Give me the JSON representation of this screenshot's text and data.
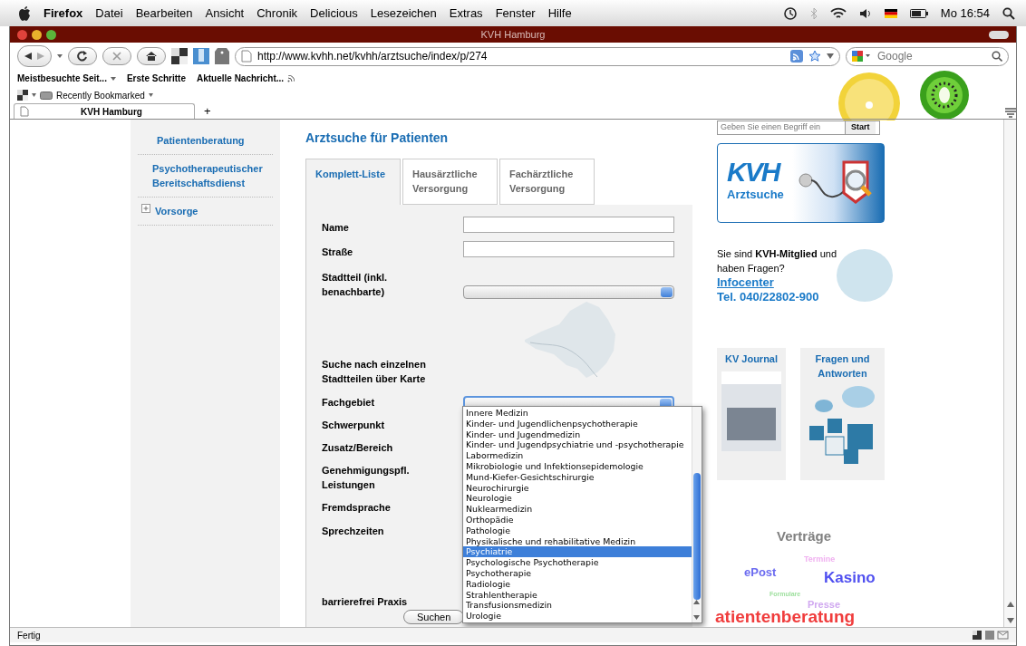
{
  "menubar": {
    "app": "Firefox",
    "menus": [
      "Datei",
      "Bearbeiten",
      "Ansicht",
      "Chronik",
      "Delicious",
      "Lesezeichen",
      "Extras",
      "Fenster",
      "Hilfe"
    ],
    "clock": "Mo 16:54"
  },
  "window": {
    "title": "KVH Hamburg"
  },
  "toolbar": {
    "url": "http://www.kvhh.net/kvhh/arztsuche/index/p/274",
    "search_placeholder": "Google"
  },
  "bookmarks": [
    {
      "label": "Meistbesuchte Seit...",
      "kind": "menu"
    },
    {
      "label": "Erste Schritte",
      "kind": "plain"
    },
    {
      "label": "Aktuelle Nachricht...",
      "kind": "feed"
    }
  ],
  "bookmarks_bar2": {
    "label": "Recently Bookmarked"
  },
  "tabs": [
    {
      "label": "KVH Hamburg",
      "selected": true
    }
  ],
  "new_tab": "+",
  "sidebar": {
    "items": [
      {
        "label": "Patientenberatung",
        "kind": "link"
      },
      {
        "label": "Psychotherapeutischer Bereitschaftsdienst",
        "kind": "link"
      },
      {
        "label": "Vorsorge",
        "kind": "expandable"
      }
    ]
  },
  "main": {
    "title": "Arztsuche für Patienten",
    "tabs": [
      {
        "label": "Komplett-Liste",
        "selected": true
      },
      {
        "label": "Hausärztliche Versorgung",
        "selected": false
      },
      {
        "label": "Fachärztliche Versorgung",
        "selected": false
      }
    ],
    "fields": [
      {
        "label": "Name",
        "kind": "text"
      },
      {
        "label": "Straße",
        "kind": "text"
      },
      {
        "label": "Stadtteil (inkl. benachbarte)",
        "kind": "select",
        "focused": false
      },
      {
        "label": "Suche nach einzelnen Stadtteilen über Karte",
        "kind": "map"
      },
      {
        "label": "Fachgebiet",
        "kind": "select",
        "focused": true
      },
      {
        "label": "Schwerpunkt",
        "kind": "plain"
      },
      {
        "label": "Zusatz/Bereich",
        "kind": "plain"
      },
      {
        "label": "Genehmigungspfl. Leistungen",
        "kind": "plain"
      },
      {
        "label": "Fremdsprache",
        "kind": "plain"
      },
      {
        "label": "Sprechzeiten",
        "kind": "plain"
      },
      {
        "label": "barrierefrei Praxis",
        "kind": "plain"
      }
    ],
    "submit": "Suchen",
    "dropdown": [
      {
        "label": "Innere Medizin",
        "selected": false
      },
      {
        "label": "Kinder- und Jugendlichenpsychotherapie",
        "selected": false
      },
      {
        "label": "Kinder- und Jugendmedizin",
        "selected": false
      },
      {
        "label": "Kinder- und Jugendpsychiatrie und -psychotherapie",
        "selected": false
      },
      {
        "label": "Labormedizin",
        "selected": false
      },
      {
        "label": "Mikrobiologie und Infektionsepidemologie",
        "selected": false
      },
      {
        "label": "Mund-Kiefer-Gesichtschirurgie",
        "selected": false
      },
      {
        "label": "Neurochirurgie",
        "selected": false
      },
      {
        "label": "Neurologie",
        "selected": false
      },
      {
        "label": "Nuklearmedizin",
        "selected": false
      },
      {
        "label": "Orthopädie",
        "selected": false
      },
      {
        "label": "Pathologie",
        "selected": false
      },
      {
        "label": "Physikalische und rehabilitative Medizin",
        "selected": false
      },
      {
        "label": "Psychiatrie",
        "selected": true
      },
      {
        "label": "Psychologische Psychotherapie",
        "selected": false
      },
      {
        "label": "Psychotherapie",
        "selected": false
      },
      {
        "label": "Radiologie",
        "selected": false
      },
      {
        "label": "Strahlentherapie",
        "selected": false
      },
      {
        "label": "Transfusionsmedizin",
        "selected": false
      },
      {
        "label": "Urologie",
        "selected": false
      }
    ]
  },
  "right": {
    "site_search": {
      "placeholder": "Geben Sie einen Begriff ein",
      "button": "Start"
    },
    "banner": {
      "logo": "KVH",
      "label": "Arztsuche"
    },
    "infocenter": {
      "text": "Sie sind **KVH-Mitglied** und haben Fragen?",
      "link": "Infocenter",
      "phone": "Tel. 040/22802-900"
    },
    "tiles": [
      {
        "title": "KV Journal",
        "kind": "journal"
      },
      {
        "title": "Fragen und Antworten",
        "kind": "faq"
      }
    ],
    "tag_cloud": [
      {
        "label": "Verträge",
        "color": "#808080",
        "kind": "large"
      },
      {
        "label": "ePost",
        "color": "#6b6bf0",
        "kind": "medium"
      },
      {
        "label": "Termine",
        "color": "#f0b0f0",
        "kind": "tiny"
      },
      {
        "label": "Kasino",
        "color": "#5050f0",
        "kind": "large"
      },
      {
        "label": "Formulare",
        "color": "#a0e0a0",
        "kind": "micro"
      },
      {
        "label": "Presse",
        "color": "#d0a8f0",
        "kind": "small"
      },
      {
        "label": "atientenberatung",
        "color": "#f03c3c",
        "kind": "huge"
      }
    ]
  },
  "status_bar": "Fertig"
}
